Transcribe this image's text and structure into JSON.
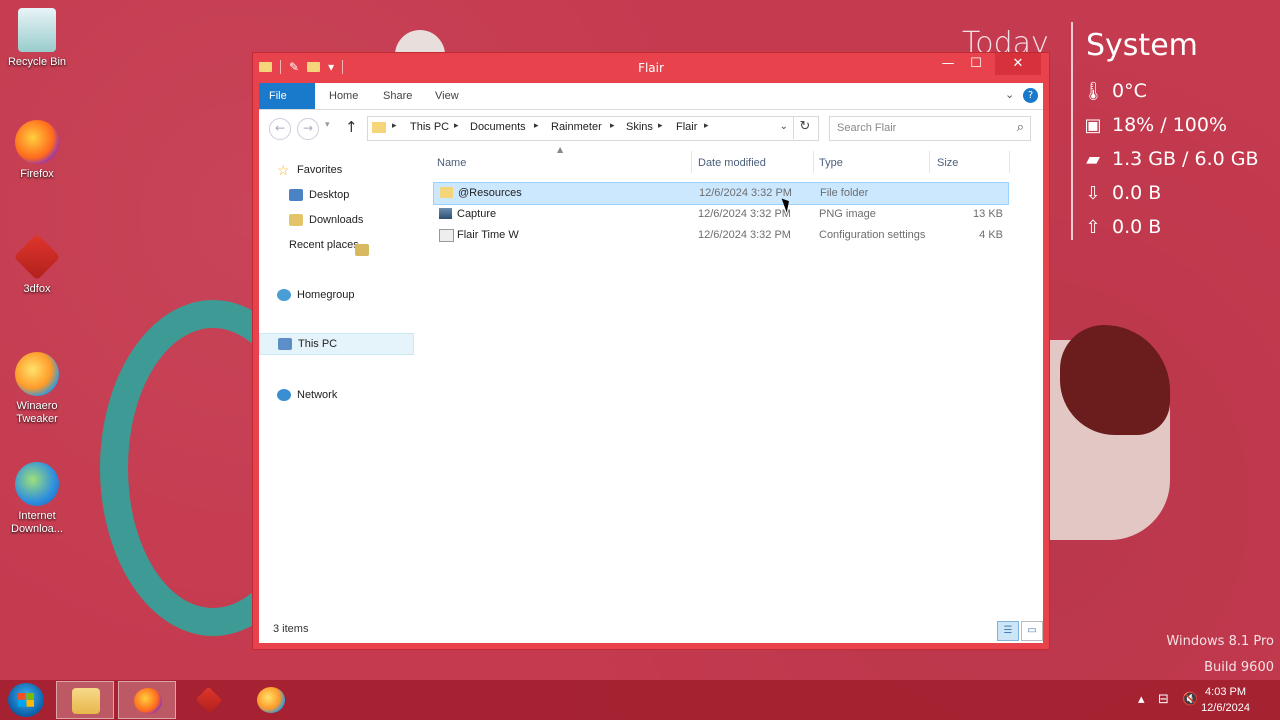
{
  "desktop": {
    "icons": [
      {
        "label_lines": [
          "Recycle Bin"
        ],
        "icon": "recycle-bin-icon"
      },
      {
        "label_lines": [
          "Firefox"
        ],
        "icon": "firefox-icon"
      },
      {
        "label_lines": [
          "3dfox"
        ],
        "icon": "3dfox-icon"
      },
      {
        "label_lines": [
          "Winaero",
          "Tweaker"
        ],
        "icon": "winaero-tweaker-icon"
      },
      {
        "label_lines": [
          "Internet",
          "Downloa..."
        ],
        "icon": "internet-download-manager-icon"
      }
    ]
  },
  "rainmeter": {
    "today": "Today",
    "system_title": "System",
    "temperature": "0°C",
    "cpu": "18% / 100%",
    "ram": "1.3 GB / 6.0 GB",
    "download": "0.0 B",
    "upload": "0.0 B"
  },
  "watermark": {
    "edition": "Windows 8.1 Pro",
    "build": "Build 9600"
  },
  "window": {
    "title": "Flair",
    "controls": {
      "minimize": "—",
      "maximize": "☐",
      "close": "✕"
    },
    "ribbon_tabs": [
      "File",
      "Home",
      "Share",
      "View"
    ],
    "address": {
      "crumbs": [
        "This PC",
        "Documents",
        "Rainmeter",
        "Skins",
        "Flair"
      ]
    },
    "search_placeholder": "Search Flair",
    "sidebar": {
      "favorites": "Favorites",
      "favorites_items": [
        "Desktop",
        "Downloads",
        "Recent places"
      ],
      "homegroup": "Homegroup",
      "this_pc": "This PC",
      "network": "Network"
    },
    "columns": {
      "name": "Name",
      "date": "Date modified",
      "type": "Type",
      "size": "Size"
    },
    "files": [
      {
        "name": "@Resources",
        "date": "12/6/2024 3:32 PM",
        "type": "File folder",
        "size": "",
        "icon": "folder-icon",
        "selected": true
      },
      {
        "name": "Capture",
        "date": "12/6/2024 3:32 PM",
        "type": "PNG image",
        "size": "13 KB",
        "icon": "png-file-icon",
        "selected": false
      },
      {
        "name": "Flair Time W",
        "date": "12/6/2024 3:32 PM",
        "type": "Configuration settings",
        "size": "4 KB",
        "icon": "config-file-icon",
        "selected": false
      }
    ],
    "status": "3 items"
  },
  "taskbar": {
    "clock_time": "4:03 PM",
    "clock_date": "12/6/2024"
  }
}
